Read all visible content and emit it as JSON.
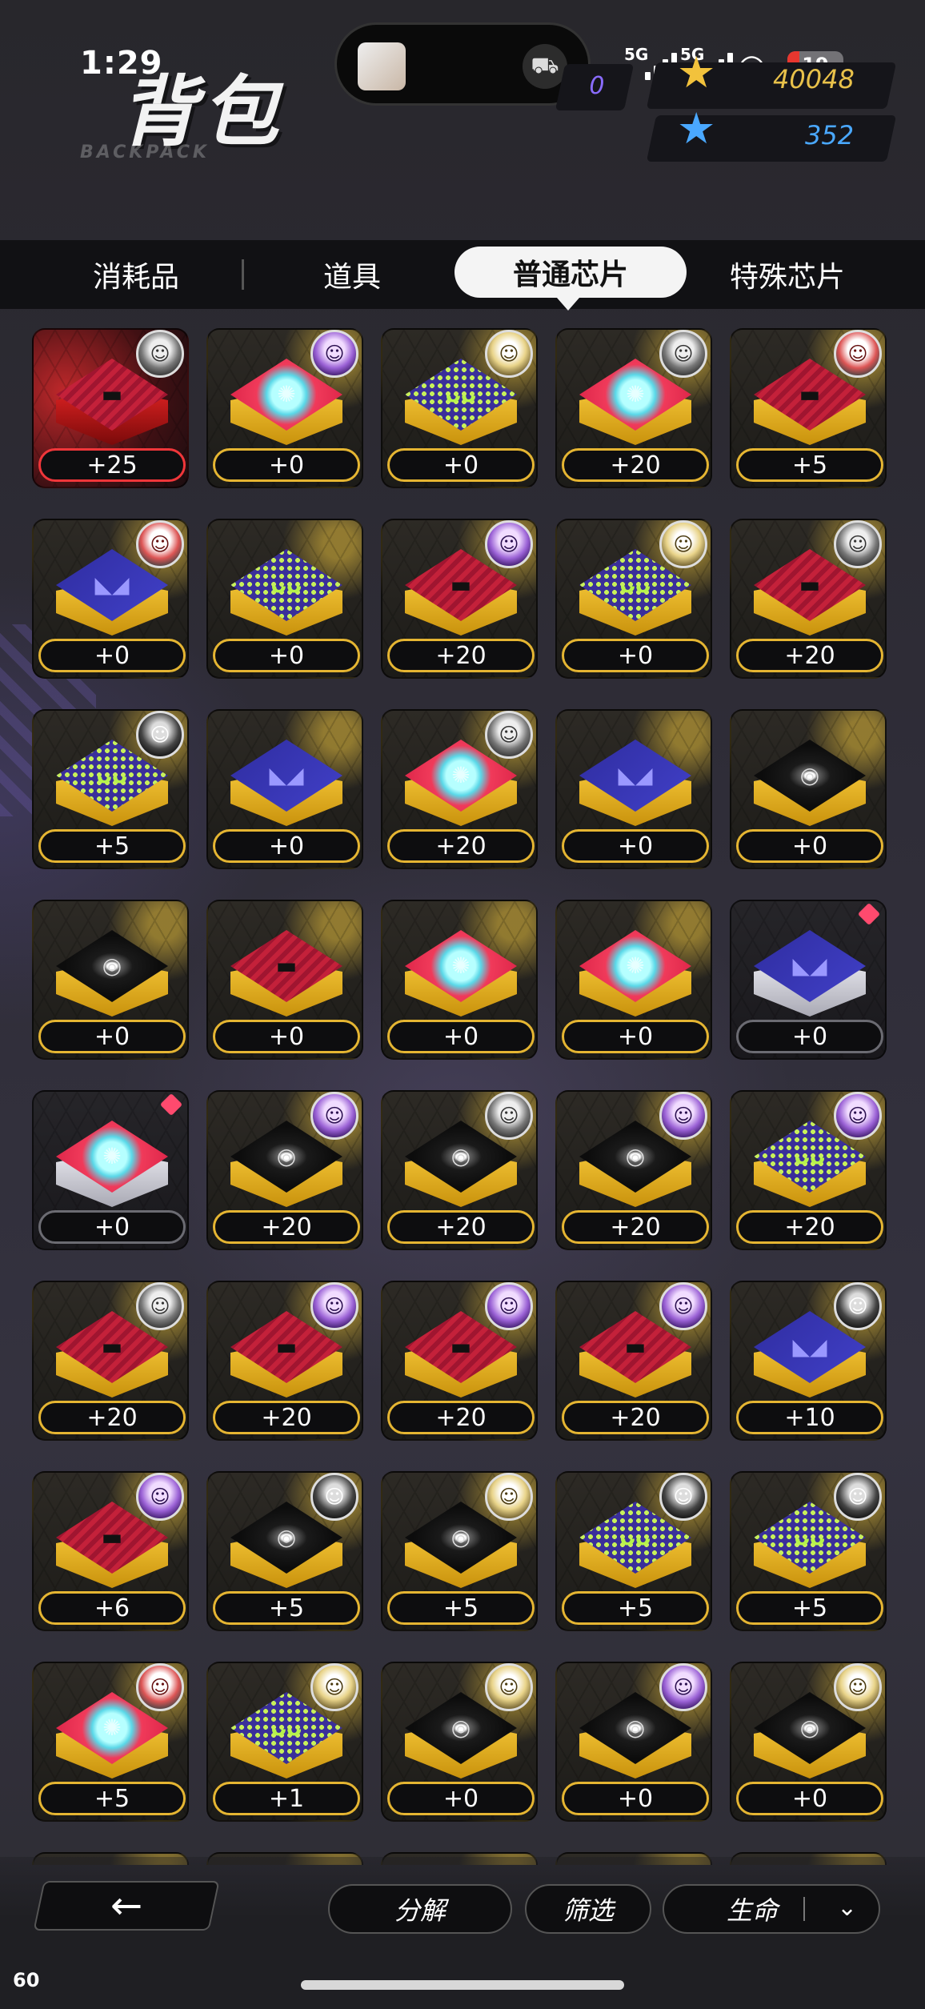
{
  "status_bar": {
    "time": "1:29",
    "sim1_label": "5G",
    "sim2_label": "5G",
    "battery": "19",
    "island_icon": "car-icon"
  },
  "header": {
    "title": "背包",
    "subtitle": "BACKPACK"
  },
  "currency": {
    "fragment_value": "0",
    "gold_value": "40048",
    "star_value": "352"
  },
  "tabs": [
    {
      "label": "消耗品",
      "active": false
    },
    {
      "label": "道具",
      "active": false
    },
    {
      "label": "普通芯片",
      "active": true
    },
    {
      "label": "特殊芯片",
      "active": false
    }
  ],
  "chips": [
    {
      "level": "+25",
      "type": "bullet",
      "frame": "red",
      "avatar": "gray"
    },
    {
      "level": "+0",
      "type": "brain",
      "frame": "gold",
      "avatar": "purple"
    },
    {
      "level": "+0",
      "type": "dots",
      "frame": "gold",
      "avatar": "blond"
    },
    {
      "level": "+20",
      "type": "brain",
      "frame": "gold",
      "avatar": "gray"
    },
    {
      "level": "+5",
      "type": "bullet",
      "frame": "gold",
      "avatar": "pink"
    },
    {
      "level": "+0",
      "type": "chevron",
      "frame": "gold",
      "avatar": "pink"
    },
    {
      "level": "+0",
      "type": "dots",
      "frame": "gold",
      "avatar": ""
    },
    {
      "level": "+20",
      "type": "bullet",
      "frame": "gold",
      "avatar": "purple"
    },
    {
      "level": "+0",
      "type": "dots",
      "frame": "gold",
      "avatar": "blond"
    },
    {
      "level": "+20",
      "type": "bullet",
      "frame": "gold",
      "avatar": "gray"
    },
    {
      "level": "+5",
      "type": "dots",
      "frame": "gold",
      "avatar": "dark"
    },
    {
      "level": "+0",
      "type": "chevron",
      "frame": "gold",
      "avatar": ""
    },
    {
      "level": "+20",
      "type": "brain",
      "frame": "gold",
      "avatar": "gray"
    },
    {
      "level": "+0",
      "type": "chevron",
      "frame": "gold",
      "avatar": ""
    },
    {
      "level": "+0",
      "type": "swirl",
      "frame": "gold",
      "avatar": ""
    },
    {
      "level": "+0",
      "type": "swirl",
      "frame": "gold",
      "avatar": ""
    },
    {
      "level": "+0",
      "type": "bullet",
      "frame": "gold",
      "avatar": ""
    },
    {
      "level": "+0",
      "type": "brain",
      "frame": "gold",
      "avatar": ""
    },
    {
      "level": "+0",
      "type": "brain",
      "frame": "gold",
      "avatar": ""
    },
    {
      "level": "+0",
      "type": "chevron",
      "frame": "gray",
      "avatar": "",
      "pip": true
    },
    {
      "level": "+0",
      "type": "brain",
      "frame": "gray",
      "avatar": "",
      "pip": true
    },
    {
      "level": "+20",
      "type": "swirl",
      "frame": "gold",
      "avatar": "purple"
    },
    {
      "level": "+20",
      "type": "swirl",
      "frame": "gold",
      "avatar": "gray"
    },
    {
      "level": "+20",
      "type": "swirl",
      "frame": "gold",
      "avatar": "purple"
    },
    {
      "level": "+20",
      "type": "dots",
      "frame": "gold",
      "avatar": "purple"
    },
    {
      "level": "+20",
      "type": "bullet",
      "frame": "gold",
      "avatar": "gray"
    },
    {
      "level": "+20",
      "type": "bullet",
      "frame": "gold",
      "avatar": "purple"
    },
    {
      "level": "+20",
      "type": "bullet",
      "frame": "gold",
      "avatar": "purple"
    },
    {
      "level": "+20",
      "type": "bullet",
      "frame": "gold",
      "avatar": "purple"
    },
    {
      "level": "+10",
      "type": "chevron",
      "frame": "gold",
      "avatar": "dark"
    },
    {
      "level": "+6",
      "type": "bullet",
      "frame": "gold",
      "avatar": "purple"
    },
    {
      "level": "+5",
      "type": "swirl",
      "frame": "gold",
      "avatar": "dark"
    },
    {
      "level": "+5",
      "type": "swirl",
      "frame": "gold",
      "avatar": "blond"
    },
    {
      "level": "+5",
      "type": "dots",
      "frame": "gold",
      "avatar": "dark"
    },
    {
      "level": "+5",
      "type": "dots",
      "frame": "gold",
      "avatar": "dark"
    },
    {
      "level": "+5",
      "type": "brain",
      "frame": "gold",
      "avatar": "pink"
    },
    {
      "level": "+1",
      "type": "dots",
      "frame": "gold",
      "avatar": "blond"
    },
    {
      "level": "+0",
      "type": "swirl",
      "frame": "gold",
      "avatar": "blond"
    },
    {
      "level": "+0",
      "type": "swirl",
      "frame": "gold",
      "avatar": "purple"
    },
    {
      "level": "+0",
      "type": "swirl",
      "frame": "gold",
      "avatar": "blond"
    }
  ],
  "bottom_bar": {
    "back_icon": "back-arrow-icon",
    "decompose_label": "分解",
    "filter_label": "筛选",
    "sort_label": "生命",
    "dropdown_icon": "chevron-down-icon",
    "fps": "60"
  },
  "colors": {
    "gold_frame": "#e5b532",
    "red_frame": "#f0363a",
    "tab_active_bg": "#f4f4f4",
    "currency_blue": "#4aa8ff",
    "currency_gold": "#e8c14a"
  }
}
